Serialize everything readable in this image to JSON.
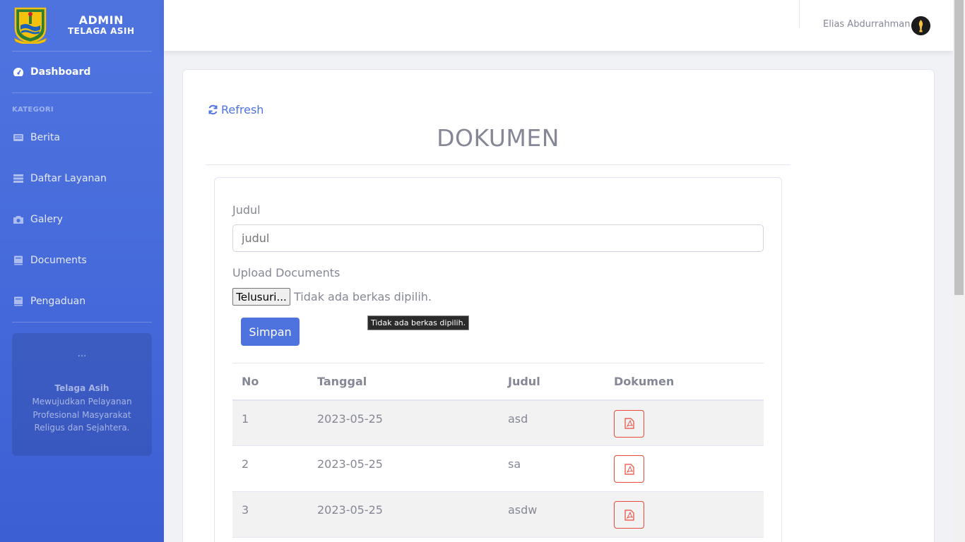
{
  "brand": {
    "title": "ADMIN",
    "subtitle": "TELAGA ASIH"
  },
  "sidebar": {
    "dashboard": "Dashboard",
    "heading": "KATEGORI",
    "items": [
      {
        "label": "Berita",
        "icon": "newspaper-icon"
      },
      {
        "label": "Daftar Layanan",
        "icon": "list-icon"
      },
      {
        "label": "Galery",
        "icon": "camera-icon"
      },
      {
        "label": "Documents",
        "icon": "book-icon"
      },
      {
        "label": "Pengaduan",
        "icon": "book-icon"
      }
    ],
    "card": {
      "dots": "...",
      "title": "Telaga Asih",
      "description": "Mewujudkan Pelayanan Profesional Masyarakat Religus dan Sejahtera."
    }
  },
  "topbar": {
    "user_name": "Elias Abdurrahman"
  },
  "content": {
    "refresh": "Refresh",
    "title": "DOKUMEN",
    "form": {
      "judul_label": "Judul",
      "judul_placeholder": "judul",
      "upload_label": "Upload Documents",
      "browse_button": "Telusuri...",
      "file_status": "Tidak ada berkas dipilih.",
      "tooltip": "Tidak ada berkas dipilih.",
      "save_button": "Simpan"
    },
    "table": {
      "headers": [
        "No",
        "Tanggal",
        "Judul",
        "Dokumen"
      ],
      "rows": [
        {
          "no": "1",
          "tanggal": "2023-05-25",
          "judul": "asd"
        },
        {
          "no": "2",
          "tanggal": "2023-05-25",
          "judul": "sa"
        },
        {
          "no": "3",
          "tanggal": "2023-05-25",
          "judul": "asdw"
        }
      ]
    }
  },
  "colors": {
    "primary": "#4e73df",
    "danger": "#e74a3b",
    "text": "#858796"
  }
}
